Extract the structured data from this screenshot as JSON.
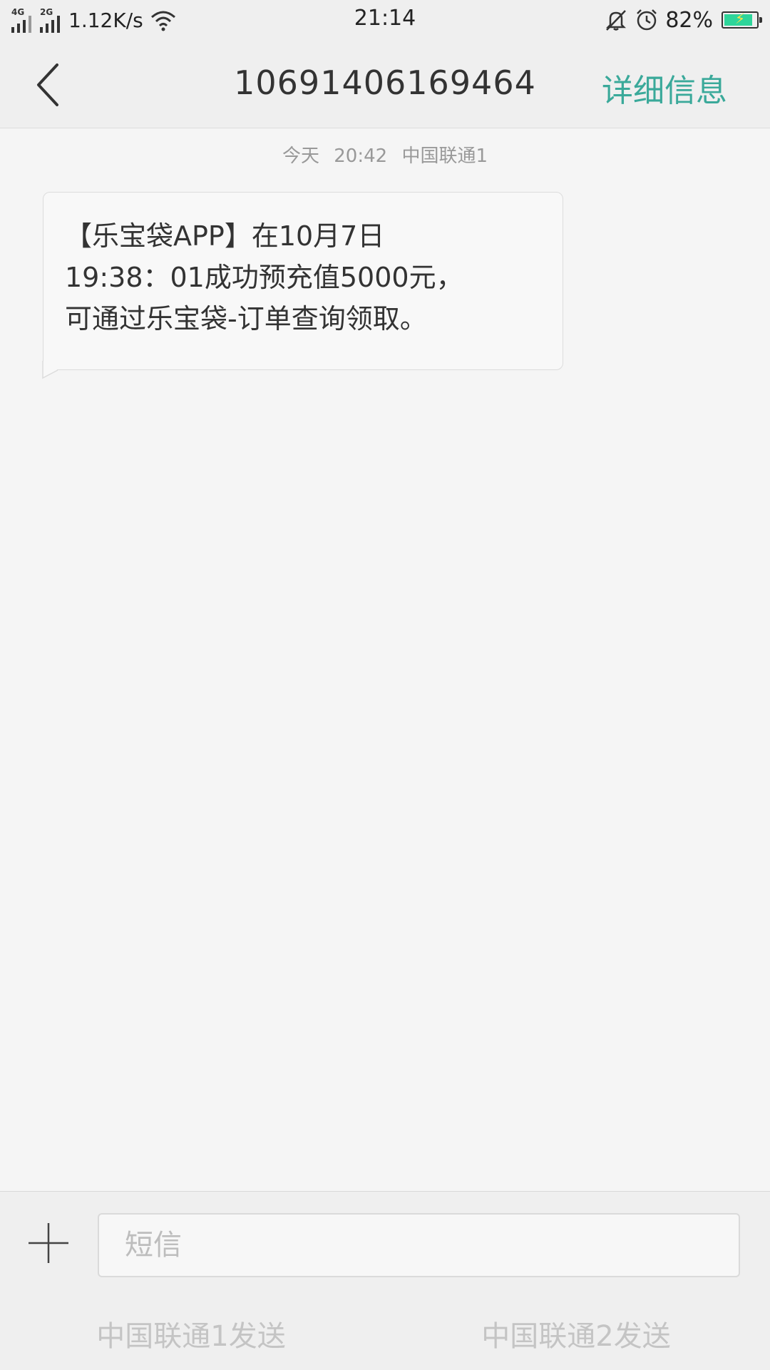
{
  "status_bar": {
    "network_1": "4G",
    "network_2": "2G",
    "speed": "1.12K/s",
    "time": "21:14",
    "battery_percent": "82%",
    "battery_level": 0.82,
    "icons": [
      "signal-icon",
      "wifi-icon",
      "bell-muted-icon",
      "alarm-icon",
      "battery-icon"
    ]
  },
  "header": {
    "title": "10691406169464",
    "details_label": "详细信息"
  },
  "messages": [
    {
      "date": "今天",
      "time": "20:42",
      "sim": "中国联通1",
      "lines": [
        "【乐宝袋APP】在10月7日",
        "19:38：01成功预充值5000元，",
        "可通过乐宝袋-订单查询领取。"
      ]
    }
  ],
  "compose": {
    "placeholder": "短信",
    "send_sim1": "中国联通1发送",
    "send_sim2": "中国联通2发送"
  },
  "colors": {
    "accent": "#3aa99a",
    "battery": "#2ed59a",
    "background": "#f5f5f5"
  }
}
